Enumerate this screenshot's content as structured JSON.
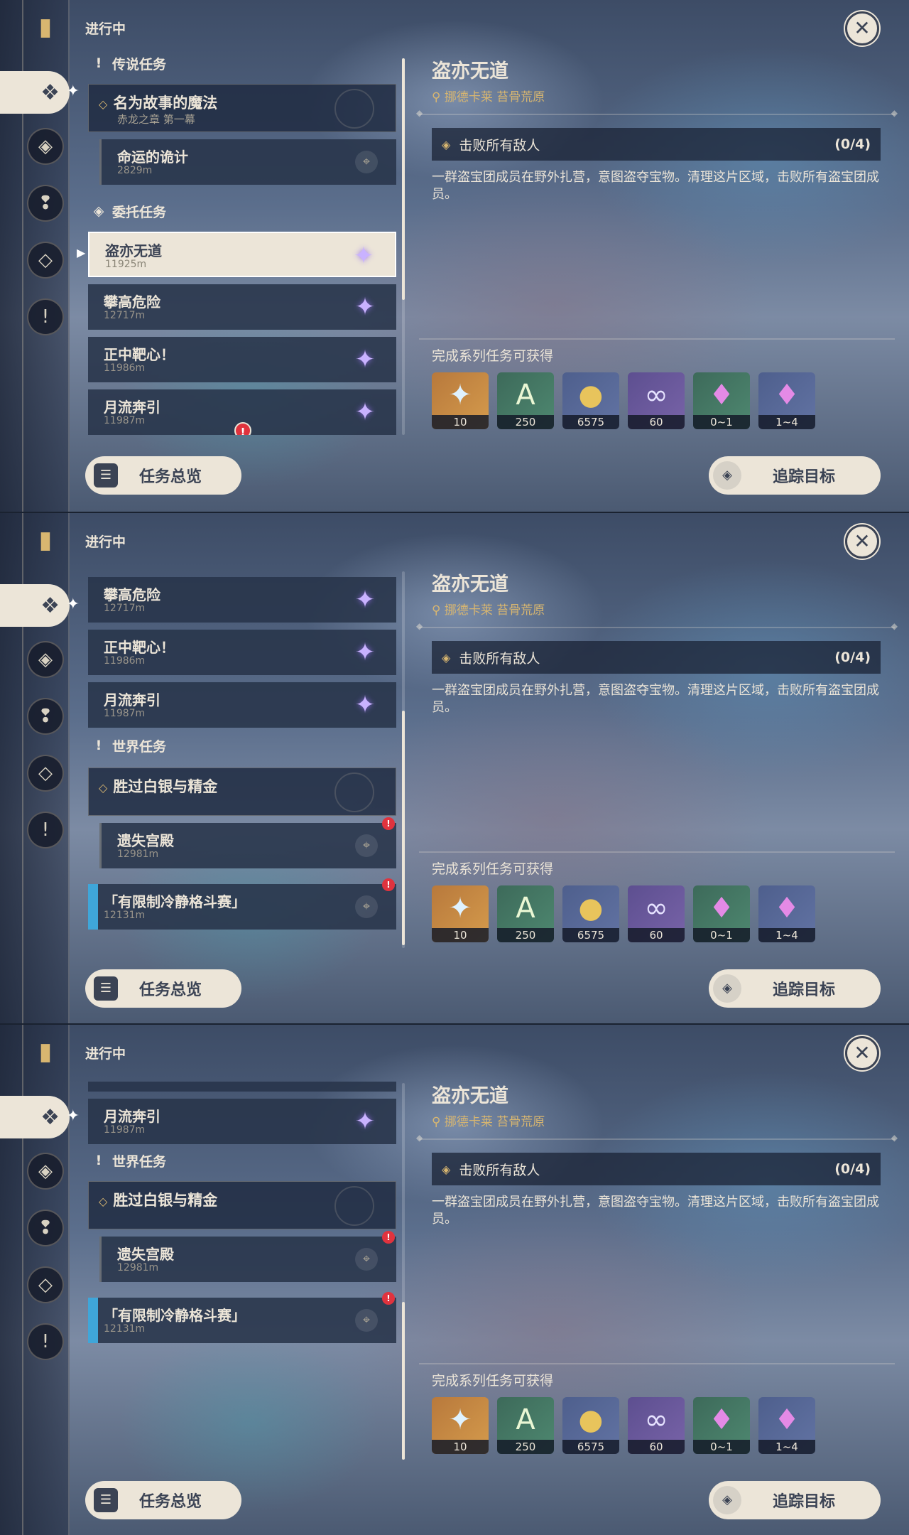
{
  "ui": {
    "in_progress": "进行中",
    "overview_button": "任务总览",
    "track_button": "追踪目标",
    "close": "✕"
  },
  "categories": {
    "legend": "传说任务",
    "commission": "委托任务",
    "world": "世界任务"
  },
  "quests": {
    "legend_group_title": "名为故事的魔法",
    "legend_group_sub": "赤龙之章 第一幕",
    "legend_sub_title": "命运的诡计",
    "legend_sub_dist": "2829m",
    "commission_1_title": "盗亦无道",
    "commission_1_dist": "11925m",
    "commission_2_title": "攀高危险",
    "commission_2_dist": "12717m",
    "commission_3_title": "正中靶心！",
    "commission_3_dist": "11986m",
    "commission_4_title": "月流奔引",
    "commission_4_dist": "11987m",
    "world_group_title": "胜过白银与精金",
    "world_sub_title": "遗失宫殿",
    "world_sub_dist": "12981m",
    "world_2_title": "「有限制冷静格斗赛」",
    "world_2_dist": "12131m"
  },
  "detail": {
    "title": "盗亦无道",
    "location": "挪德卡莱 苔骨荒原",
    "objective": "击败所有敌人",
    "objective_count": "(0/4)",
    "description": "一群盗宝团成员在野外扎营，意图盗夺宝物。清理这片区域，击败所有盗宝团成员。",
    "rewards_label": "完成系列任务可获得"
  },
  "rewards": [
    {
      "item": "primogem-icon",
      "count": "10"
    },
    {
      "item": "adventure-exp-icon",
      "count": "250"
    },
    {
      "item": "mora-icon",
      "count": "6575"
    },
    {
      "item": "companionship-exp-icon",
      "count": "60"
    },
    {
      "item": "crystal-chunk-icon",
      "count": "0~1"
    },
    {
      "item": "crystal-ore-icon",
      "count": "1~4"
    }
  ],
  "colors": {
    "accent_gold": "#d8b670",
    "panel_cream": "#ece5d8",
    "commission_star": "#c9b2ff",
    "alert_red": "#e0333e",
    "world_blue": "#3fa6d9"
  },
  "scroll_position_fraction": [
    0.0,
    0.35,
    0.55
  ]
}
